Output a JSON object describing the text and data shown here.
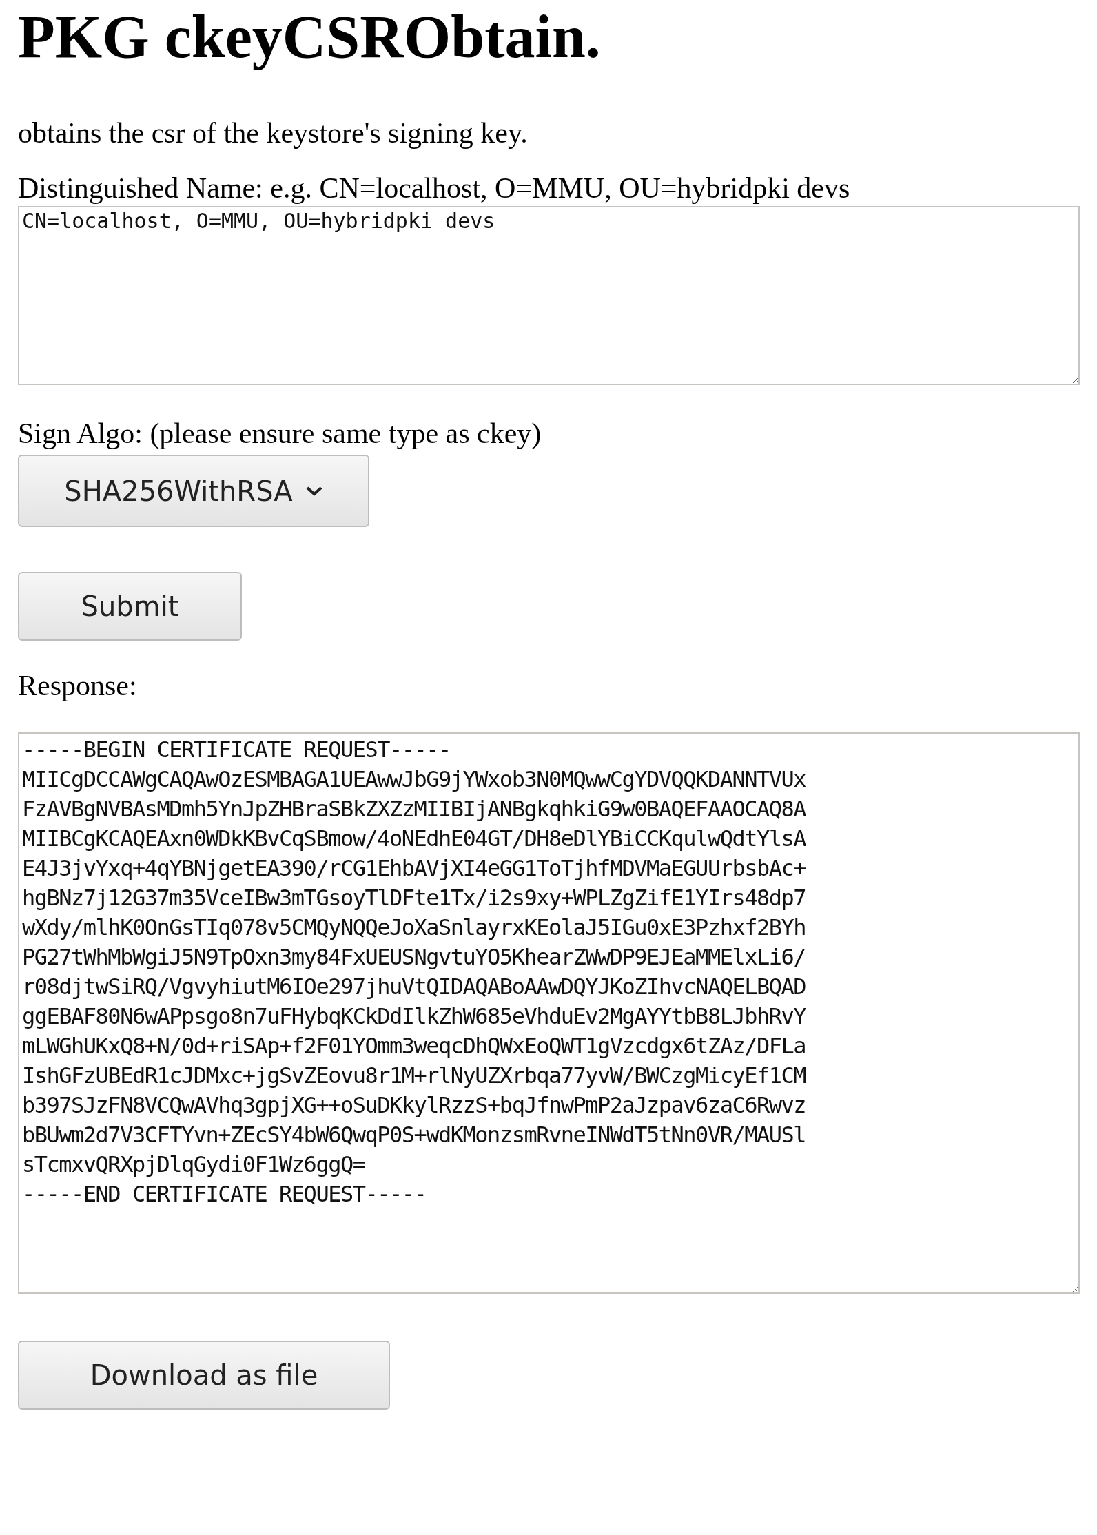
{
  "title": "PKG ckeyCSRObtain.",
  "description": "obtains the csr of the keystore's signing key.",
  "dn_field": {
    "label": "Distinguished Name: e.g. CN=localhost, O=MMU, OU=hybridpki devs",
    "value": "CN=localhost, O=MMU, OU=hybridpki devs"
  },
  "sign_algo": {
    "label": "Sign Algo: (please ensure same type as ckey)",
    "value": "SHA256WithRSA"
  },
  "submit_button": "Submit",
  "response": {
    "label": "Response:",
    "lines": [
      "-----BEGIN CERTIFICATE REQUEST-----",
      "MIICgDCCAWgCAQAwOzESMBAGA1UEAwwJbG9jYWxob3N0MQwwCgYDVQQKDANNTVUx",
      "FzAVBgNVBAsMDmh5YnJpZHBraSBkZXZzMIIBIjANBgkqhkiG9w0BAQEFAAOCAQ8A",
      "MIIBCgKCAQEAxn0WDkKBvCqSBmow/4oNEdhE04GT/DH8eDlYBiCCKqulwQdtYlsA",
      "E4J3jvYxq+4qYBNjgetEA390/rCG1EhbAVjXI4eGG1ToTjhfMDVMaEGUUrbsbAc+",
      "hgBNz7j12G37m35VceIBw3mTGsoyTlDFte1Tx/i2s9xy+WPLZgZifE1YIrs48dp7",
      "wXdy/mlhK0OnGsTIq078v5CMQyNQQeJoXaSnlayrxKEolaJ5IGu0xE3Pzhxf2BYh",
      "PG27tWhMbWgiJ5N9TpOxn3my84FxUEUSNgvtuYO5KhearZWwDP9EJEaMMElxLi6/",
      "r08djtwSiRQ/VgvyhiutM6IOe297jhuVtQIDAQABoAAwDQYJKoZIhvcNAQELBQAD",
      "ggEBAF80N6wAPpsgo8n7uFHybqKCkDdIlkZhW685eVhduEv2MgAYYtbB8LJbhRvY",
      "mLWGhUKxQ8+N/0d+riSAp+f2F01YOmm3weqcDhQWxEoQWT1gVzcdgx6tZAz/DFLa",
      "IshGFzUBEdR1cJDMxc+jgSvZEovu8r1M+rlNyUZXrbqa77yvW/BWCzgMicyEf1CM",
      "b397SJzFN8VCQwAVhq3gpjXG++oSuDKkylRzzS+bqJfnwPmP2aJzpav6zaC6Rwvz",
      "bBUwm2d7V3CFTYvn+ZEcSY4bW6QwqP0S+wdKMonzsmRvneINWdT5tNn0VR/MAUSl",
      "sTcmxvQRXpjDlqGydi0F1Wz6ggQ=",
      "-----END CERTIFICATE REQUEST-----"
    ]
  },
  "download_button": "Download as file"
}
